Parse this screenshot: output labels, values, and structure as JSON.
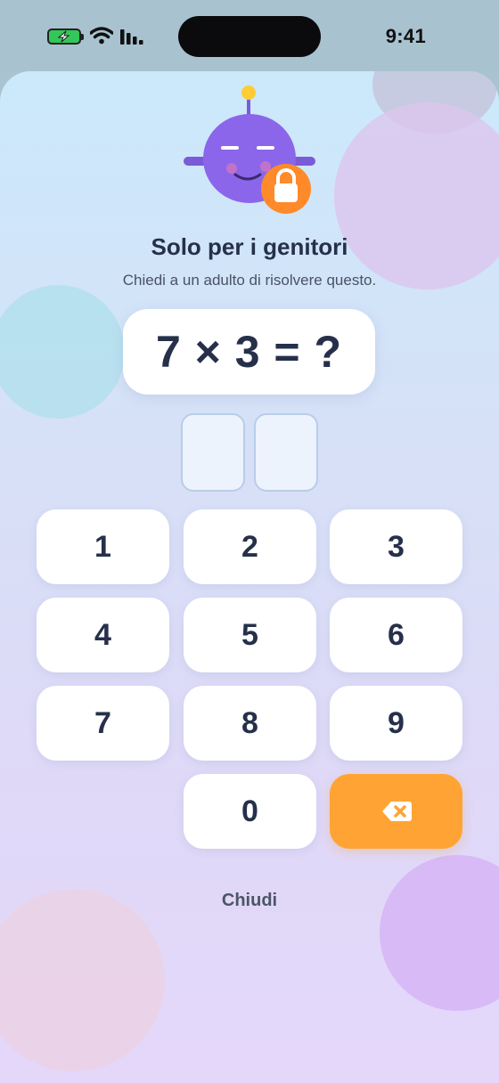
{
  "status_bar": {
    "time": "9:41",
    "battery_icon": "battery-charging-icon",
    "wifi_icon": "wifi-icon",
    "signal_icon": "cellular-signal-icon"
  },
  "mascot": {
    "icon": "robot-mascot-icon",
    "badge_icon": "lock-icon",
    "colors": {
      "body": "#8b66ea",
      "badge": "#ff8a2a",
      "antenna": "#ffcc33"
    }
  },
  "gate": {
    "title": "Solo per i genitori",
    "subtitle": "Chiedi a un adulto di risolvere questo.",
    "question": "7 × 3 = ?",
    "answer_digits": [
      "",
      ""
    ]
  },
  "keypad": {
    "keys": [
      "1",
      "2",
      "3",
      "4",
      "5",
      "6",
      "7",
      "8",
      "9",
      "0"
    ],
    "backspace_icon": "backspace-icon",
    "accent_color": "#ffa434"
  },
  "close_label": "Chiudi"
}
